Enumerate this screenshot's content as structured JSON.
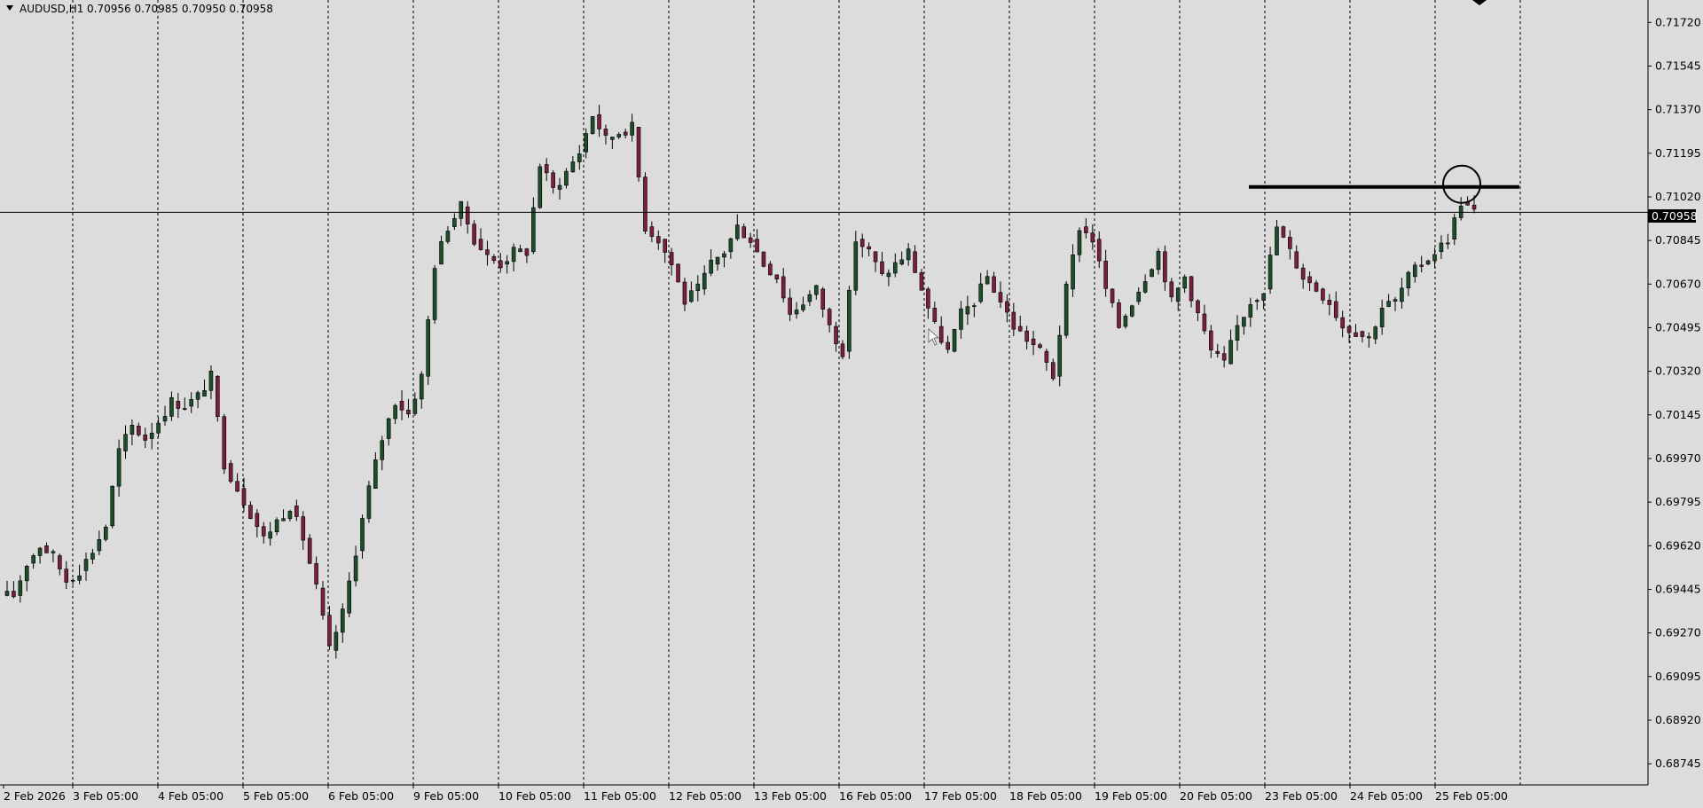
{
  "header": {
    "symbol": "AUDUSD,H1",
    "ohlc": "0.70956 0.70985 0.70950 0.70958"
  },
  "current_price_label": "0.70958",
  "colors": {
    "background": "#dcdcdc",
    "grid": "#000000",
    "bull": "#1e4d2b",
    "bear": "#7a1f3d",
    "wick": "#000000",
    "price_tag_bg": "#000000",
    "price_tag_text": "#ffffff"
  },
  "chart_data": {
    "type": "candlestick",
    "symbol": "AUDUSD",
    "timeframe": "H1",
    "ylim": [
      0.6866,
      0.7181
    ],
    "y_ticks": [
      "0.71720",
      "0.71545",
      "0.71370",
      "0.71195",
      "0.71020",
      "0.70845",
      "0.70670",
      "0.70495",
      "0.70320",
      "0.70145",
      "0.69970",
      "0.69795",
      "0.69620",
      "0.69445",
      "0.69270",
      "0.69095",
      "0.68920",
      "0.68745"
    ],
    "x_ticks": [
      "2 Feb 2026",
      "3 Feb 05:00",
      "4 Feb 05:00",
      "5 Feb 05:00",
      "6 Feb 05:00",
      "9 Feb 05:00",
      "10 Feb 05:00",
      "11 Feb 05:00",
      "12 Feb 05:00",
      "13 Feb 05:00",
      "16 Feb 05:00",
      "17 Feb 05:00",
      "18 Feb 05:00",
      "19 Feb 05:00",
      "20 Feb 05:00",
      "23 Feb 05:00",
      "24 Feb 05:00",
      "25 Feb 05:00"
    ],
    "vgrid": "dotted vertical lines at each x tick",
    "current_price": 0.70958,
    "close_series": [
      0.6942,
      0.6955,
      0.6962,
      0.6958,
      0.6948,
      0.6952,
      0.696,
      0.697,
      0.7,
      0.701,
      0.7005,
      0.7012,
      0.702,
      0.7018,
      0.7022,
      0.703,
      0.6995,
      0.6985,
      0.6975,
      0.6965,
      0.6972,
      0.6978,
      0.6965,
      0.6945,
      0.692,
      0.6935,
      0.696,
      0.6985,
      0.7005,
      0.702,
      0.7015,
      0.703,
      0.7075,
      0.709,
      0.7098,
      0.7085,
      0.7078,
      0.7075,
      0.708,
      0.708,
      0.7115,
      0.7105,
      0.7112,
      0.712,
      0.7135,
      0.7125,
      0.7128,
      0.713,
      0.709,
      0.7085,
      0.7075,
      0.706,
      0.7065,
      0.7075,
      0.708,
      0.709,
      0.7085,
      0.7075,
      0.707,
      0.7055,
      0.706,
      0.7065,
      0.705,
      0.704,
      0.7085,
      0.708,
      0.707,
      0.7075,
      0.708,
      0.7065,
      0.705,
      0.704,
      0.7055,
      0.706,
      0.707,
      0.706,
      0.705,
      0.7045,
      0.704,
      0.703,
      0.7065,
      0.709,
      0.7085,
      0.7065,
      0.705,
      0.706,
      0.707,
      0.708,
      0.706,
      0.707,
      0.7055,
      0.704,
      0.7035,
      0.705,
      0.706,
      0.7065,
      0.709,
      0.708,
      0.707,
      0.7065,
      0.706,
      0.705,
      0.7048,
      0.7045,
      0.7058,
      0.706,
      0.707,
      0.7075,
      0.708,
      0.7085,
      0.71,
      0.7096
    ],
    "annotations": [
      {
        "type": "horizontal-line",
        "price": 0.7106,
        "from": "20 Feb 05:00",
        "to": "25 Feb 05:00"
      },
      {
        "type": "circle",
        "around": "25 Feb 05:00 high"
      },
      {
        "type": "horizontal-line",
        "price": 0.70958,
        "label": "current price"
      }
    ]
  }
}
